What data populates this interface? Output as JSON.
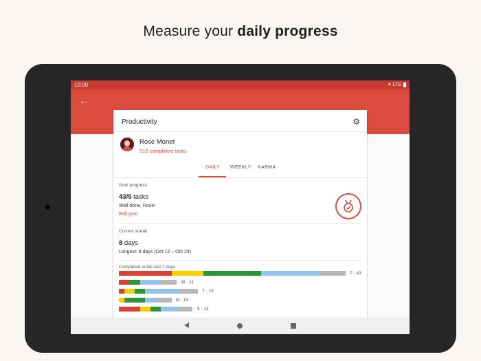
{
  "headline": {
    "prefix": "Measure your ",
    "bold": "daily progress"
  },
  "status_bar": {
    "time": "10:00",
    "network": "LTE"
  },
  "card": {
    "title": "Productivity",
    "user": {
      "name": "Rose Monet",
      "completed": "512 completed tasks"
    },
    "tabs": [
      {
        "label": "DAILY",
        "active": true
      },
      {
        "label": "WEEKLY",
        "active": false
      },
      {
        "label": "KARMA",
        "active": false
      }
    ],
    "goal": {
      "label": "Goal progress",
      "value": "43/5",
      "unit": " tasks",
      "message": "Well done, Rose!",
      "edit_label": "Edit goal"
    },
    "streak": {
      "label": "Current streak",
      "value": "8",
      "unit": " days",
      "longest": "Longest: 8 days (Oct 12 – Oct 24)"
    },
    "history": {
      "label": "Completed in the last 7 days",
      "colors": {
        "red": "#db4035",
        "yellow": "#fad000",
        "green": "#299438",
        "blue": "#96c3eb",
        "gray": "#b8b8b8"
      },
      "days": [
        {
          "label": "T · 43",
          "total": 43,
          "segments": [
            {
              "color": "red",
              "value": 10
            },
            {
              "color": "yellow",
              "value": 6
            },
            {
              "color": "green",
              "value": 11
            },
            {
              "color": "blue",
              "value": 11
            },
            {
              "color": "gray",
              "value": 5
            }
          ]
        },
        {
          "label": "W · 11",
          "total": 11,
          "segments": [
            {
              "color": "red",
              "value": 2
            },
            {
              "color": "green",
              "value": 2
            },
            {
              "color": "blue",
              "value": 4
            },
            {
              "color": "gray",
              "value": 3
            }
          ]
        },
        {
          "label": "T · 15",
          "total": 15,
          "segments": [
            {
              "color": "red",
              "value": 1
            },
            {
              "color": "yellow",
              "value": 2
            },
            {
              "color": "green",
              "value": 2
            },
            {
              "color": "blue",
              "value": 6
            },
            {
              "color": "gray",
              "value": 4
            }
          ]
        },
        {
          "label": "M · 10",
          "total": 10,
          "segments": [
            {
              "color": "yellow",
              "value": 1
            },
            {
              "color": "green",
              "value": 4
            },
            {
              "color": "blue",
              "value": 2
            },
            {
              "color": "gray",
              "value": 3
            }
          ]
        },
        {
          "label": "S · 14",
          "total": 14,
          "segments": [
            {
              "color": "red",
              "value": 4
            },
            {
              "color": "yellow",
              "value": 2
            },
            {
              "color": "green",
              "value": 2
            },
            {
              "color": "blue",
              "value": 3
            },
            {
              "color": "gray",
              "value": 3
            }
          ]
        }
      ]
    }
  },
  "icons": {
    "back": "arrow-left-icon",
    "settings": "gear-icon",
    "medal": "medal-icon",
    "nav_back": "triangle-back-icon",
    "nav_home": "circle-home-icon",
    "nav_recent": "square-recent-icon"
  },
  "theme": {
    "accent": "#db4c3f",
    "status_bar": "#c73a31"
  }
}
